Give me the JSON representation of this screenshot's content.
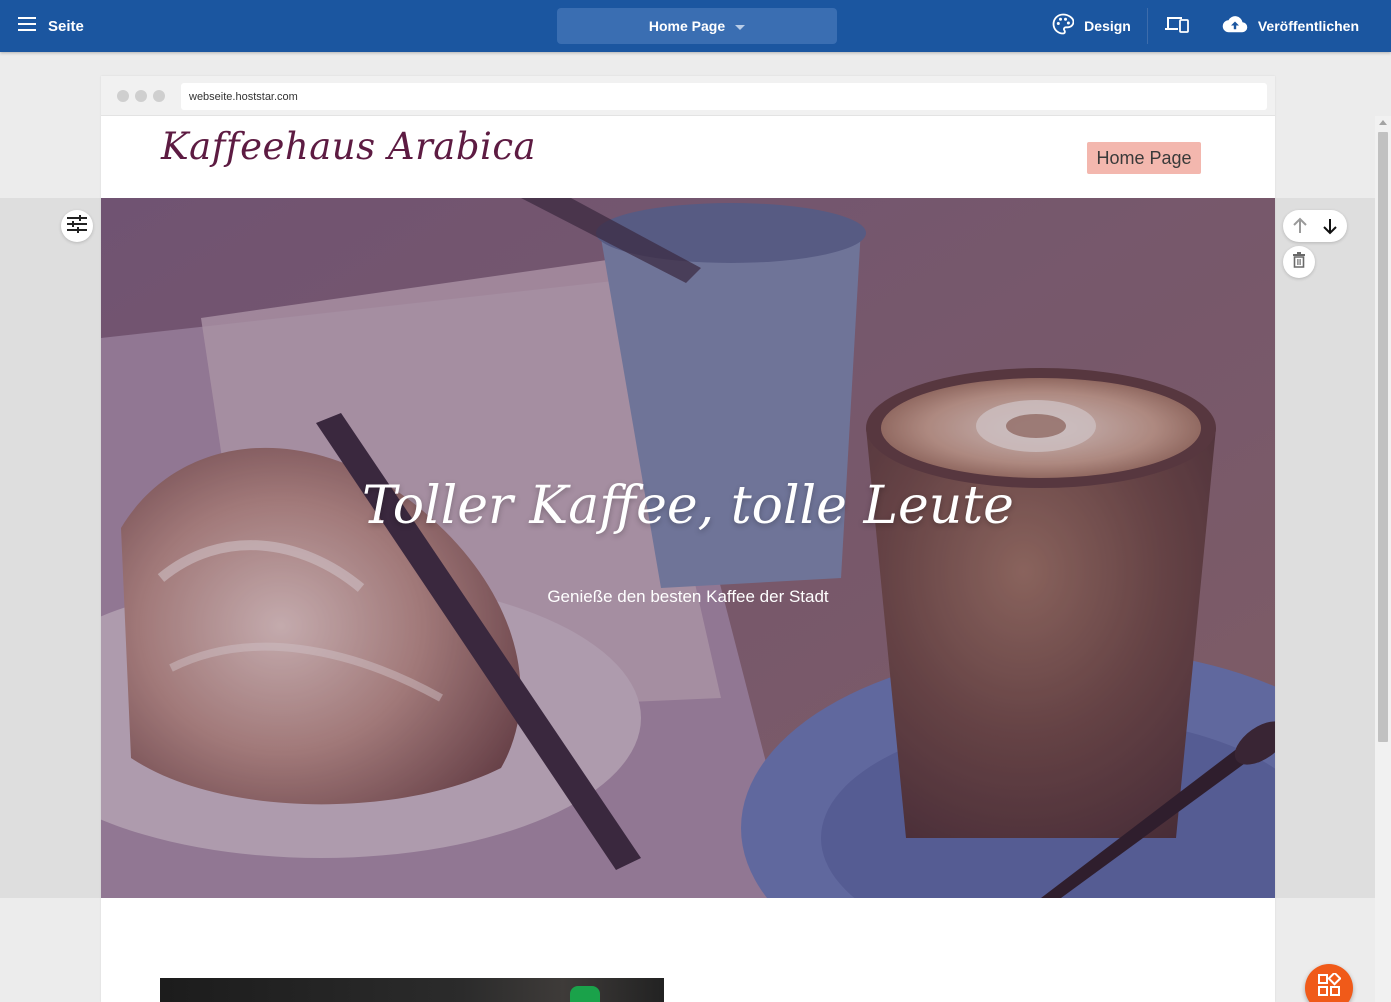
{
  "app_bar": {
    "menu_label": "Seite",
    "page_selector": "Home Page",
    "design_label": "Design",
    "publish_label": "Veröffentlichen"
  },
  "browser": {
    "url": "webseite.hoststar.com"
  },
  "site": {
    "logo": "Kaffeehaus Arabica",
    "nav_items": [
      "Home Page"
    ],
    "hero_title": "Toller Kaffee, tolle Leute",
    "hero_subtitle": "Genieße den besten Kaffee der Stadt"
  },
  "colors": {
    "appbar": "#1b56a0",
    "brand": "#5d1b42",
    "nav_highlight": "#f3b7ae",
    "fab": "#f05a19"
  },
  "icons": [
    "menu-icon",
    "palette-icon",
    "devices-icon",
    "cloud-upload-icon",
    "tune-icon",
    "arrow-up-icon",
    "arrow-down-icon",
    "trash-icon",
    "add-widget-icon"
  ]
}
